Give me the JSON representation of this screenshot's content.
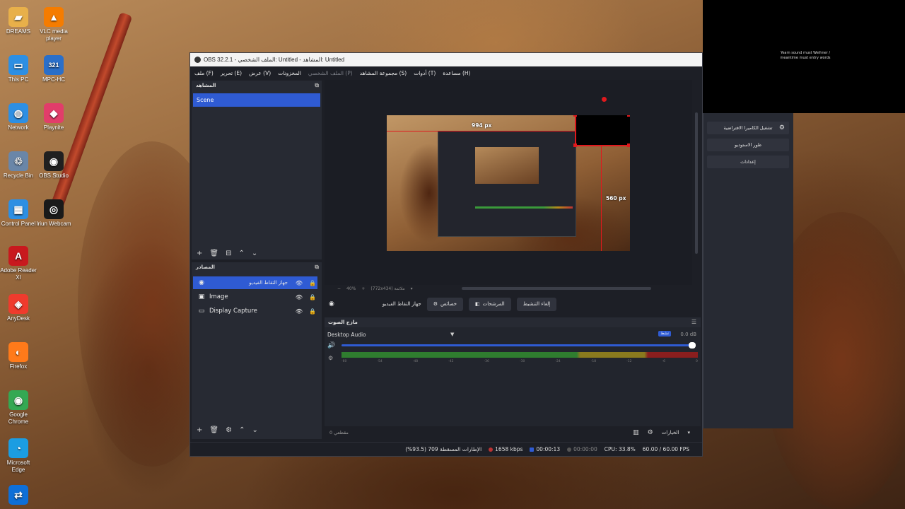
{
  "desktop": {
    "icons": [
      {
        "label": "DREAMS",
        "icon": "folder-icon",
        "color": "#e8b04a"
      },
      {
        "label": "VLC media player",
        "icon": "vlc-icon",
        "color": "#f57c00"
      },
      {
        "label": "This PC",
        "icon": "pc-icon",
        "color": "#2d8fe3"
      },
      {
        "label": "MPC-HC",
        "icon": "mpc-icon",
        "color": "#2a6fc9"
      },
      {
        "label": "Network",
        "icon": "network-icon",
        "color": "#2d8fe3"
      },
      {
        "label": "Playnite",
        "icon": "playnite-icon",
        "color": "#e23d6a"
      },
      {
        "label": "Recycle Bin",
        "icon": "recycle-bin-icon",
        "color": "#6a86a8"
      },
      {
        "label": "OBS Studio",
        "icon": "obs-icon",
        "color": "#202020"
      },
      {
        "label": "Control Panel",
        "icon": "control-panel-icon",
        "color": "#2d8fe3"
      },
      {
        "label": "Iriun Webcam",
        "icon": "webcam-icon",
        "color": "#1a1a1a"
      },
      {
        "label": "Adobe Reader XI",
        "icon": "adobe-reader-icon",
        "color": "#c8191e"
      },
      {
        "label": "AnyDesk",
        "icon": "anydesk-icon",
        "color": "#ef3b2d"
      },
      {
        "label": "Firefox",
        "icon": "firefox-icon",
        "color": "#ff7a1a"
      },
      {
        "label": "Google Chrome",
        "icon": "chrome-icon",
        "color": "#34a853"
      },
      {
        "label": "Microsoft Edge",
        "icon": "edge-icon",
        "color": "#1b9de2"
      },
      {
        "label": "",
        "icon": "teamviewer-icon",
        "color": "#0e6fd8"
      }
    ]
  },
  "projector": {
    "text": "Yearn sound must Weihner / meantime must entry words"
  },
  "obs": {
    "title": "OBS 32.2.1 - الملف الشخصي: Untitled - المشاهد: Untitled",
    "menu": [
      {
        "label": "ملف (F)",
        "dim": false
      },
      {
        "label": "تحرير (E)",
        "dim": false
      },
      {
        "label": "عرض (V)",
        "dim": false
      },
      {
        "label": "المخزونات",
        "dim": false
      },
      {
        "label": "الملف الشخصي (P)",
        "dim": true
      },
      {
        "label": "مجموعة المشاهد (S)",
        "dim": false
      },
      {
        "label": "أدوات (T)",
        "dim": false
      },
      {
        "label": "مساعدة (H)",
        "dim": false
      }
    ],
    "scenes": {
      "title": "المشاهد",
      "items": [
        "Scene"
      ]
    },
    "sources": {
      "title": "المصادر",
      "items": [
        {
          "label": "جهاز التقاط الفيديو",
          "icon": "camera-icon",
          "selected": true
        },
        {
          "label": "Image",
          "icon": "image-icon",
          "selected": false
        },
        {
          "label": "Display Capture",
          "icon": "monitor-icon",
          "selected": false
        }
      ]
    },
    "preview": {
      "width_label": "994 px",
      "height_label": "560 px",
      "zoom": "40%",
      "zoom_aspect": "(772x434) ملائمة"
    },
    "context": {
      "source_name": "جهاز التقاط الفيديو",
      "properties": "خصائص",
      "filters": "المرشحات",
      "deactivate": "إلغاء التنشيط"
    },
    "mixer": {
      "title": "مازج الصوت",
      "track": "Desktop Audio",
      "db": "0.0 dB",
      "tag": "نشط",
      "ticks": [
        "-60",
        "-54",
        "-48",
        "-42",
        "-36",
        "-30",
        "-24",
        "-18",
        "-12",
        "-6",
        "0"
      ]
    },
    "mixer_footer": {
      "left": "0 مقطعي",
      "options": "الخيارات"
    },
    "status": {
      "dropped": "الإطارات المسقطة 709 (93.5%)",
      "bitrate": "1658 kbps",
      "stream_time": "00:00:13",
      "rec_time": "00:00:00",
      "cpu": "CPU: 33.8%",
      "fps": "60.00 / 60.00 FPS"
    },
    "controls": {
      "virtual_cam": "تشغيل الكاميرا الافتراضية",
      "studio_mode": "طور الاستوديو",
      "settings": "إعدادات"
    }
  }
}
